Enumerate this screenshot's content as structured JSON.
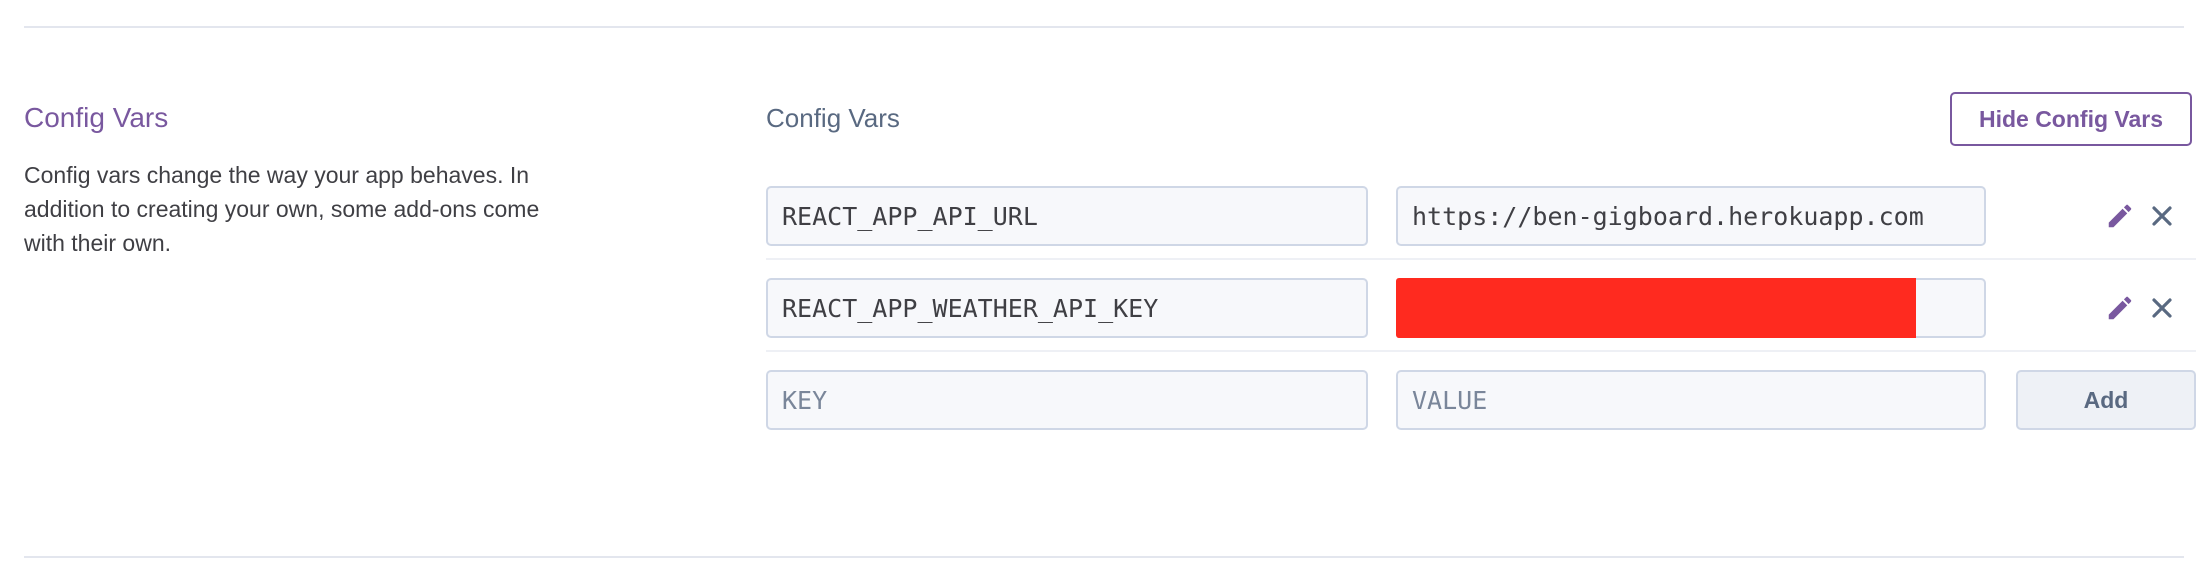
{
  "section": {
    "title": "Config Vars",
    "description": "Config vars change the way your app behaves. In addition to creating your own, some add-ons come with their own."
  },
  "panel": {
    "title": "Config Vars",
    "hide_button_label": "Hide Config Vars"
  },
  "config_vars": [
    {
      "key": "REACT_APP_API_URL",
      "value": "https://ben-gigboard.herokuapp.com",
      "value_redacted": false
    },
    {
      "key": "REACT_APP_WEATHER_API_KEY",
      "value": "",
      "value_redacted": true
    }
  ],
  "new_var": {
    "key_placeholder": "KEY",
    "value_placeholder": "VALUE",
    "add_button_label": "Add"
  },
  "colors": {
    "accent": "#79589f",
    "redaction": "#ff2a1f",
    "border": "#cfd7e6",
    "text_muted": "#596981"
  },
  "icons": {
    "edit": "pencil-icon",
    "delete": "close-icon"
  }
}
